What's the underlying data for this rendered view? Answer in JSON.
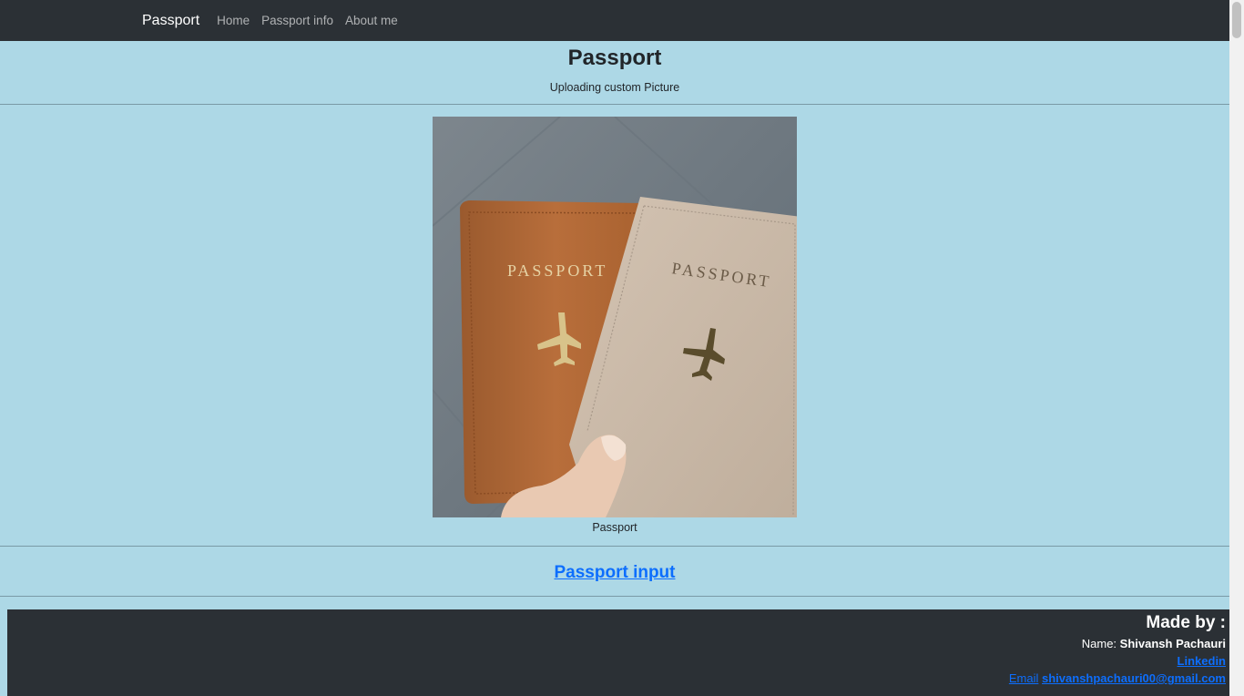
{
  "navbar": {
    "brand": "Passport",
    "links": [
      "Home",
      "Passport info",
      "About me"
    ]
  },
  "header": {
    "title": "Passport",
    "subtitle": "Uploading custom Picture"
  },
  "figure": {
    "image_text_left": "PASSPORT",
    "image_text_right": "PASSPORT",
    "caption": "Passport"
  },
  "input_link": "Passport input",
  "footer": {
    "heading": "Made by :",
    "name_label": "Name:",
    "name_value": "Shivansh Pachauri",
    "linkedin": "Linkedin",
    "email_label": "Email",
    "email_value": "shivanshpachauri00@gmail.com"
  },
  "colors": {
    "page_bg": "#add8e6",
    "navbar_bg": "#2b3035",
    "link": "#0d6efd"
  }
}
